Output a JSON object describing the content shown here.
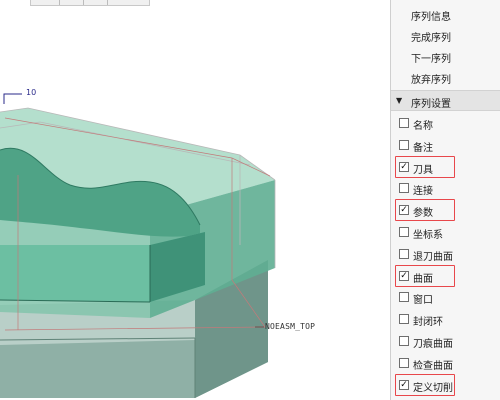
{
  "viewport": {
    "dimension_text": "10",
    "datum_label": "NOEASM_TOP",
    "colors": {
      "part_fill": "#6cbfa2",
      "part_edge": "#2f7a62",
      "workpiece_fill": "#a9d6c5",
      "base_fill": "#7aa89a"
    }
  },
  "panel": {
    "sequence_links": [
      "序列信息",
      "完成序列",
      "下一序列",
      "放弃序列"
    ],
    "section_title": "序列设置",
    "section_icon": "triangle-down-icon",
    "settings": [
      {
        "label": "名称",
        "checked": false,
        "highlighted": false
      },
      {
        "label": "备注",
        "checked": false,
        "highlighted": false
      },
      {
        "label": "刀具",
        "checked": true,
        "highlighted": true
      },
      {
        "label": "连接",
        "checked": false,
        "highlighted": false
      },
      {
        "label": "参数",
        "checked": true,
        "highlighted": true
      },
      {
        "label": "坐标系",
        "checked": false,
        "highlighted": false
      },
      {
        "label": "退刀曲面",
        "checked": false,
        "highlighted": false
      },
      {
        "label": "曲面",
        "checked": true,
        "highlighted": true
      },
      {
        "label": "窗口",
        "checked": false,
        "highlighted": false
      },
      {
        "label": "封闭环",
        "checked": false,
        "highlighted": false
      },
      {
        "label": "刀痕曲面",
        "checked": false,
        "highlighted": false
      },
      {
        "label": "检查曲面",
        "checked": false,
        "highlighted": false
      },
      {
        "label": "定义切削",
        "checked": true,
        "highlighted": true
      }
    ],
    "highlight_color": "#e8474b"
  }
}
